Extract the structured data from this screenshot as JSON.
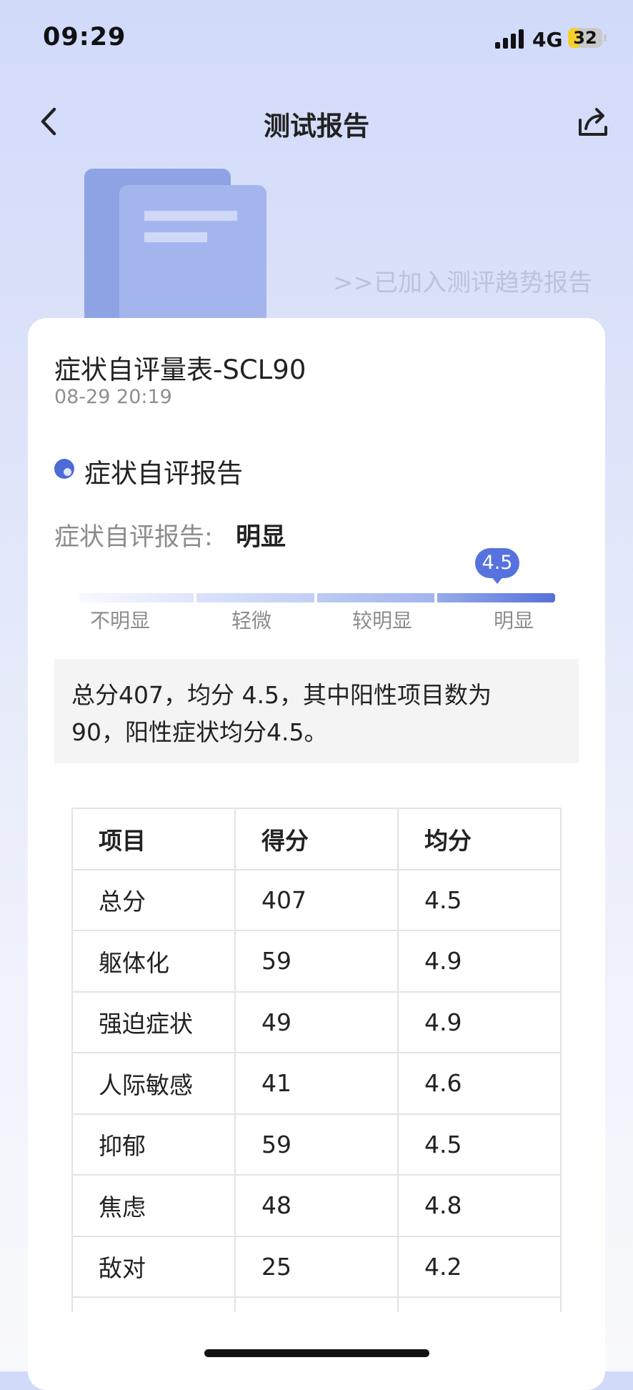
{
  "status_bar": {
    "time": "09:29",
    "network": "4G",
    "battery": "32"
  },
  "nav": {
    "title": "测试报告",
    "back_icon": "chevron-left-icon",
    "share_icon": "share-icon"
  },
  "trend_link": ">>已加入测评趋势报告",
  "report": {
    "scale_name": "症状自评量表-SCL90",
    "date": "08-29 20:19",
    "section_title": "症状自评报告",
    "result_label": "症状自评报告:",
    "result_value": "明显",
    "gauge": {
      "levels": [
        "不明显",
        "轻微",
        "较明显",
        "明显"
      ],
      "marker_value": "4.5",
      "accent_color": "#5572de"
    },
    "summary": "总分407，均分 4.5，其中阳性项目数为90，阳性症状均分4.5。"
  },
  "table": {
    "headers": [
      "项目",
      "得分",
      "均分"
    ],
    "rows": [
      [
        "总分",
        "407",
        "4.5"
      ],
      [
        "躯体化",
        "59",
        "4.9"
      ],
      [
        "强迫症状",
        "49",
        "4.9"
      ],
      [
        "人际敏感",
        "41",
        "4.6"
      ],
      [
        "抑郁",
        "59",
        "4.5"
      ],
      [
        "焦虑",
        "48",
        "4.8"
      ],
      [
        "敌对",
        "25",
        "4.2"
      ]
    ]
  }
}
